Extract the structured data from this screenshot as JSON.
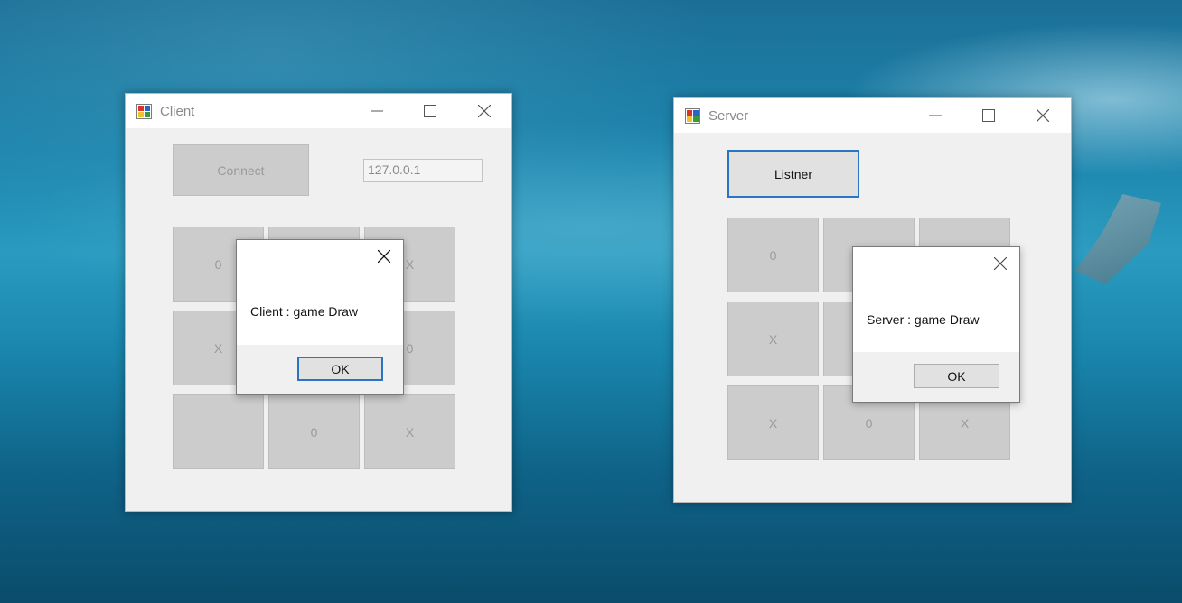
{
  "client": {
    "title": "Client",
    "connect_label": "Connect",
    "ip_value": "127.0.0.1",
    "cells": [
      "0",
      "",
      "X",
      "X",
      "",
      "0",
      "",
      "0",
      "X"
    ],
    "dialog": {
      "message": "Client : game Draw",
      "ok_label": "OK"
    }
  },
  "server": {
    "title": "Server",
    "listner_label": "Listner",
    "cells": [
      "0",
      "",
      "",
      "X",
      "",
      "",
      "X",
      "0",
      "X"
    ],
    "dialog": {
      "message": "Server : game Draw",
      "ok_label": "OK"
    }
  },
  "icons": {
    "app": "winforms-app-icon",
    "minimize": "minimize-icon",
    "maximize": "maximize-icon",
    "close": "close-icon"
  },
  "colors": {
    "accent_border": "#2b74c4",
    "window_bg": "#f0f0f0",
    "disabled_button": "#cccccc"
  }
}
